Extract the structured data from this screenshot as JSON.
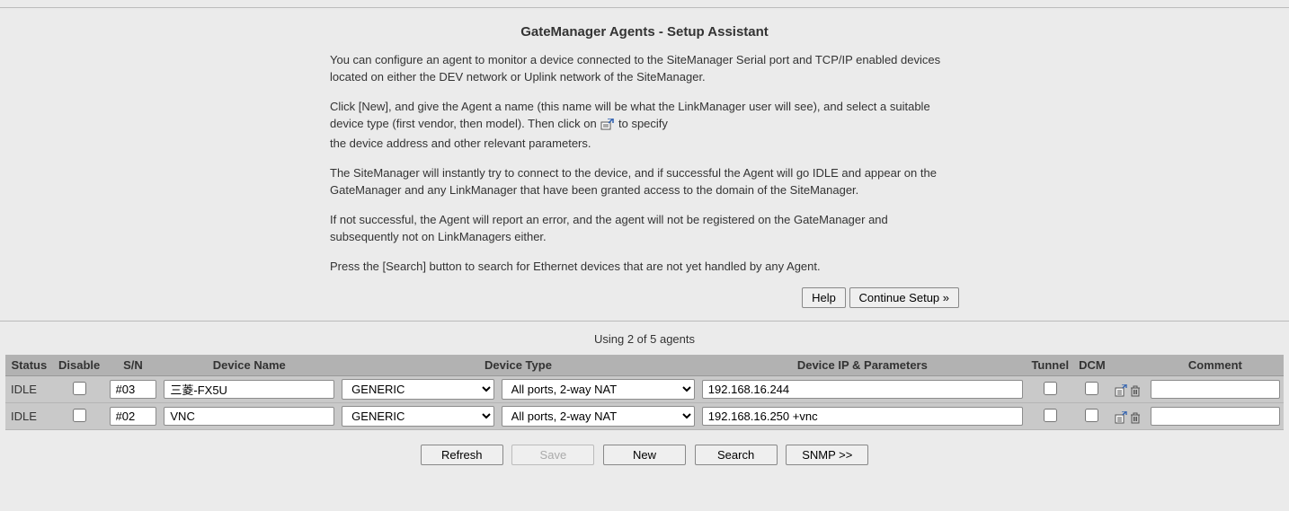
{
  "title": "GateManager Agents - Setup Assistant",
  "intro": {
    "p1": "You can configure an agent to monitor a device connected to the SiteManager Serial port and TCP/IP enabled devices located on either the DEV network or Uplink network of the SiteManager.",
    "p2a": "Click [New], and give the Agent a name (this name will be what the LinkManager user will see), and select a suitable device type (first vendor, then model). Then click on",
    "p2b": "to specify",
    "p2c": "the device address and other relevant parameters.",
    "p3": "The SiteManager will instantly try to connect to the device, and if successful the Agent will go IDLE and appear on the GateManager and any LinkManager that have been granted access to the domain of the SiteManager.",
    "p4": "If not successful, the Agent will report an error, and the agent will not be registered on the GateManager and subsequently not on LinkManagers either.",
    "p5": "Press the [Search] button to search for Ethernet devices that are not yet handled by any Agent."
  },
  "buttons": {
    "help": "Help",
    "continue": "Continue Setup »",
    "refresh": "Refresh",
    "save": "Save",
    "new": "New",
    "search": "Search",
    "snmp": "SNMP >>"
  },
  "usage": "Using 2 of 5 agents",
  "columns": {
    "status": "Status",
    "disable": "Disable",
    "sn": "S/N",
    "name": "Device Name",
    "type": "Device Type",
    "ip": "Device IP & Parameters",
    "tunnel": "Tunnel",
    "dcm": "DCM",
    "comment": "Comment"
  },
  "rows": [
    {
      "status": "IDLE",
      "disable": false,
      "sn": "#03",
      "name": "三菱-FX5U",
      "vendor": "GENERIC",
      "model": "All ports, 2-way NAT",
      "ip": "192.168.16.244",
      "tunnel": false,
      "dcm": false,
      "comment": ""
    },
    {
      "status": "IDLE",
      "disable": false,
      "sn": "#02",
      "name": "VNC",
      "vendor": "GENERIC",
      "model": "All ports, 2-way NAT",
      "ip": "192.168.16.250 +vnc",
      "tunnel": false,
      "dcm": false,
      "comment": ""
    }
  ]
}
